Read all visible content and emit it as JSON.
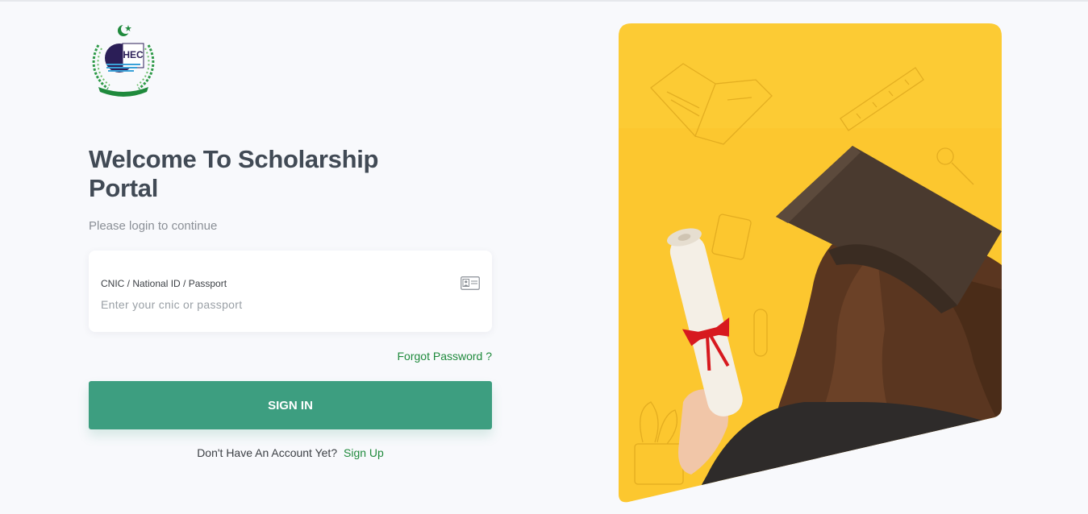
{
  "logo": {
    "text": "HEC"
  },
  "heading": {
    "title": "Welcome To Scholarship Portal",
    "subtitle": "Please login to continue"
  },
  "form": {
    "id_label": "CNIC / National ID / Passport",
    "id_placeholder": "Enter your cnic or passport",
    "id_value": "",
    "forgot_label": "Forgot Password ?",
    "signin_label": "SIGN IN",
    "no_account_text": "Don't Have An Account Yet?",
    "signup_label": "Sign Up"
  },
  "icons": {
    "id_field": "id-card-icon",
    "logo": "hec-emblem"
  },
  "colors": {
    "primary_button": "#3d9e80",
    "link_green": "#1f8a3c",
    "hero_yellow": "#fccb34",
    "title_text": "#414a55"
  }
}
